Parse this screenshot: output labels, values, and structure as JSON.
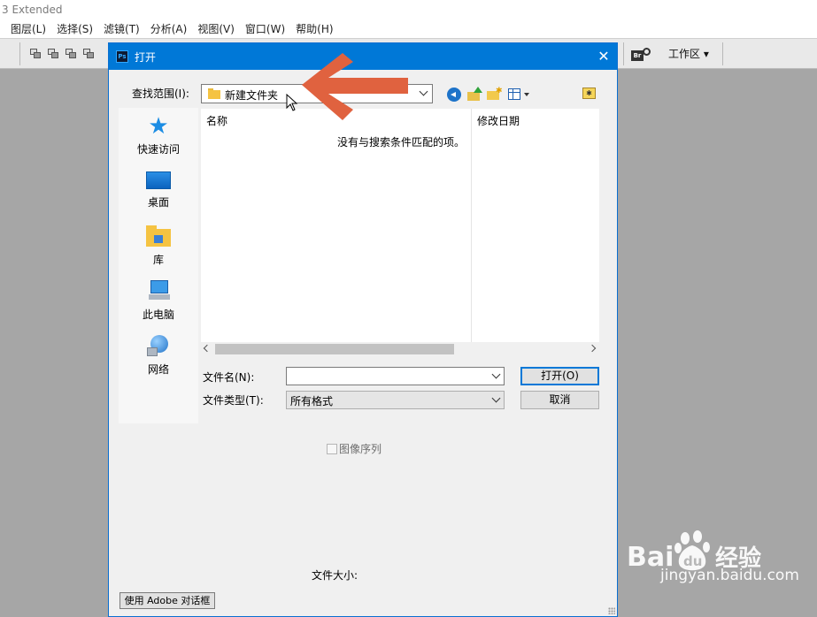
{
  "app": {
    "title": "3 Extended",
    "menu": [
      "图层(L)",
      "选择(S)",
      "滤镜(T)",
      "分析(A)",
      "视图(V)",
      "窗口(W)",
      "帮助(H)"
    ],
    "bridge_label": "Br",
    "workspace_label": "工作区 ▾"
  },
  "dialog": {
    "app_icon_label": "Ps",
    "title": "打开",
    "close_symbol": "✕",
    "look_in_label": "查找范围(I):",
    "look_in_value": "新建文件夹",
    "places": [
      {
        "label": "快速访问",
        "icon": "quick-access-star-icon"
      },
      {
        "label": "桌面",
        "icon": "desktop-icon"
      },
      {
        "label": "库",
        "icon": "library-icon"
      },
      {
        "label": "此电脑",
        "icon": "this-pc-icon"
      },
      {
        "label": "网络",
        "icon": "network-icon"
      }
    ],
    "columns": {
      "name": "名称",
      "modified": "修改日期"
    },
    "empty_message": "没有与搜索条件匹配的项。",
    "file_name_label": "文件名(N):",
    "file_name_value": "",
    "file_type_label": "文件类型(T):",
    "file_type_value": "所有格式",
    "open_button": "打开(O)",
    "cancel_button": "取消",
    "image_sequence_label": "图像序列",
    "file_size_label": "文件大小:",
    "adobe_dialog_button": "使用 Adobe 对话框"
  },
  "watermark": {
    "brand": "Bai经验",
    "url": "jingyan.baidu.com"
  },
  "colors": {
    "title_bar": "#0078d7",
    "annotation_arrow": "#e0623f",
    "folder": "#f5c342",
    "backdrop": "#a6a6a6"
  }
}
